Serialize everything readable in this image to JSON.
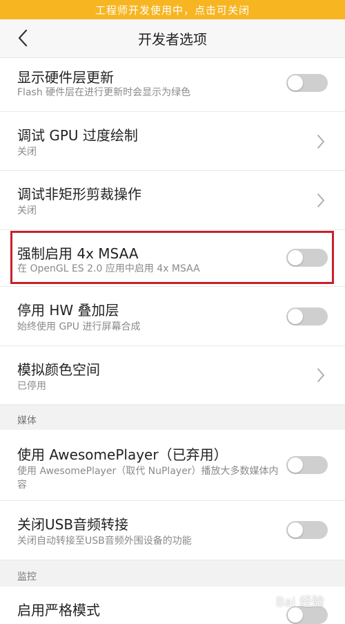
{
  "banner": {
    "text": "工程师开发使用中，点击可关闭",
    "color": "#f7b522"
  },
  "header": {
    "title": "开发者选项",
    "back_icon": "chevron-left-icon"
  },
  "rows": [
    {
      "title": "显示硬件层更新",
      "subtitle": "Flash 硬件层在进行更新时会显示为绿色",
      "control": "toggle",
      "on": false
    },
    {
      "title": "调试 GPU 过度绘制",
      "subtitle": "关闭",
      "control": "chevron"
    },
    {
      "title": "调试非矩形剪裁操作",
      "subtitle": "关闭",
      "control": "chevron"
    },
    {
      "title": "强制启用 4x MSAA",
      "subtitle": "在 OpenGL ES 2.0 应用中启用 4x MSAA",
      "control": "toggle",
      "on": false
    },
    {
      "title": "停用 HW 叠加层",
      "subtitle": "始终使用 GPU 进行屏幕合成",
      "control": "toggle",
      "on": false
    },
    {
      "title": "模拟颜色空间",
      "subtitle": "已停用",
      "control": "chevron"
    }
  ],
  "sections": {
    "media": {
      "label": "媒体",
      "rows": [
        {
          "title": "使用 AwesomePlayer（已弃用）",
          "subtitle": "使用 AwesomePlayer（取代 NuPlayer）播放大多数媒体内容",
          "control": "toggle",
          "on": false
        },
        {
          "title": "关闭USB音频转接",
          "subtitle": "关闭自动转接至USB音频外围设备的功能",
          "control": "toggle",
          "on": false
        }
      ]
    },
    "monitor": {
      "label": "监控",
      "rows": [
        {
          "title": "启用严格模式",
          "control": "toggle",
          "on": false
        }
      ]
    }
  },
  "highlight_color": "#c8202a",
  "watermark": "Bai 经验"
}
